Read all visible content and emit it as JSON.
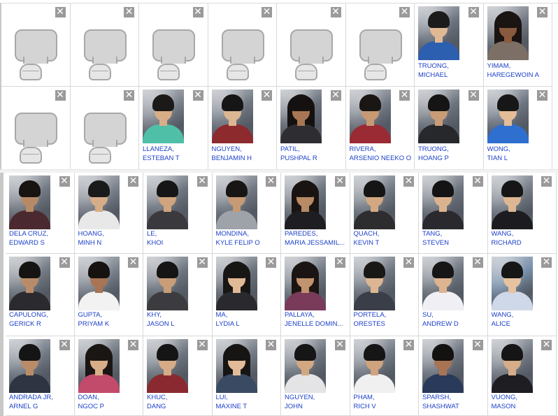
{
  "close_glyph": "✕",
  "placeholder_icon": "silhouette-placeholder-icon",
  "section1": [
    {
      "type": "placeholder"
    },
    {
      "type": "placeholder"
    },
    {
      "type": "placeholder"
    },
    {
      "type": "placeholder"
    },
    {
      "type": "placeholder"
    },
    {
      "type": "placeholder"
    },
    {
      "type": "student",
      "last": "TRUONG,",
      "first": "MICHAEL",
      "bg": "#6d7480",
      "shirt": "#2c5fb0",
      "skin": "#e0b894",
      "hair": "#1b1b1b",
      "longhair": false
    },
    {
      "type": "student",
      "last": "YIMAM,",
      "first": "HAREGEWOIN A",
      "bg": "#767c86",
      "shirt": "#7c6f66",
      "skin": "#8a5a3e",
      "hair": "#1a1412",
      "longhair": true
    },
    {
      "type": "placeholder"
    },
    {
      "type": "placeholder"
    },
    {
      "type": "student",
      "last": "LLANEZA,",
      "first": "ESTEBAN T",
      "bg": "#7b818a",
      "shirt": "#4fbfa8",
      "skin": "#d8ae88",
      "hair": "#1c1a18",
      "longhair": false
    },
    {
      "type": "student",
      "last": "NGUYEN,",
      "first": "BENJAMIN H",
      "bg": "#707781",
      "shirt": "#8d2a2e",
      "skin": "#dcb592",
      "hair": "#161616",
      "longhair": false
    },
    {
      "type": "student",
      "last": "PATIL,",
      "first": "PUSHPAL R",
      "bg": "#6a717b",
      "shirt": "#2e2e32",
      "skin": "#a87654",
      "hair": "#141110",
      "longhair": true
    },
    {
      "type": "student",
      "last": "RIVERA,",
      "first": "ARSENIO NEEKO O",
      "bg": "#747a84",
      "shirt": "#9a2a34",
      "skin": "#c79a74",
      "hair": "#191614",
      "longhair": false
    },
    {
      "type": "student",
      "last": "TRUONG,",
      "first": "HOANG P",
      "bg": "#6d747e",
      "shirt": "#26282c",
      "skin": "#c99c76",
      "hair": "#151515",
      "longhair": false
    },
    {
      "type": "student",
      "last": "WONG,",
      "first": "TIAN L",
      "bg": "#6c7480",
      "shirt": "#2f6fd0",
      "skin": "#e3bc98",
      "hair": "#171717",
      "longhair": false
    }
  ],
  "section2": [
    {
      "last": "DELA CRUZ,",
      "first": "EDWARD S",
      "bg": "#737983",
      "shirt": "#4a2a30",
      "skin": "#b78a66",
      "hair": "#171412",
      "longhair": false
    },
    {
      "last": "HOANG,",
      "first": "MINH N",
      "bg": "#7a808a",
      "shirt": "#e8e8e8",
      "skin": "#d6ad88",
      "hair": "#1a1a1a",
      "longhair": false
    },
    {
      "last": "LE,",
      "first": "KHOI",
      "bg": "#6e757f",
      "shirt": "#3a3a3e",
      "skin": "#cfa47e",
      "hair": "#161616",
      "longhair": false
    },
    {
      "last": "MONDINA,",
      "first": "KYLE FELIP O",
      "bg": "#717882",
      "shirt": "#9ea3aa",
      "skin": "#c59a74",
      "hair": "#181614",
      "longhair": false
    },
    {
      "last": "PAREDES,",
      "first": "MARIA JESSAMIL...",
      "bg": "#6f7680",
      "shirt": "#1e1e22",
      "skin": "#b98a66",
      "hair": "#191411",
      "longhair": true
    },
    {
      "last": "QUACH,",
      "first": "KEVIN T",
      "bg": "#737a84",
      "shirt": "#2d2d30",
      "skin": "#d2a882",
      "hair": "#151515",
      "longhair": false
    },
    {
      "last": "TANG,",
      "first": "STEVEN",
      "bg": "#6c737d",
      "shirt": "#2a2a2e",
      "skin": "#dab38e",
      "hair": "#141414",
      "longhair": false
    },
    {
      "last": "WANG,",
      "first": "RICHARD",
      "bg": "#767d87",
      "shirt": "#1c1c20",
      "skin": "#ddb692",
      "hair": "#161616",
      "longhair": false
    },
    {
      "last": "CAPULONG,",
      "first": "GERICK R",
      "bg": "#727983",
      "shirt": "#2b2b2f",
      "skin": "#b88c68",
      "hair": "#161412",
      "longhair": false
    },
    {
      "last": "GUPTA,",
      "first": "PRIYAM K",
      "bg": "#7a818b",
      "shirt": "#f2f2f2",
      "skin": "#a87454",
      "hair": "#151210",
      "longhair": false
    },
    {
      "last": "KHY,",
      "first": "JASON L",
      "bg": "#6e757f",
      "shirt": "#3c3c40",
      "skin": "#c99d78",
      "hair": "#151515",
      "longhair": false
    },
    {
      "last": "MA,",
      "first": "LYDIA L",
      "bg": "#6b727c",
      "shirt": "#2a2a2e",
      "skin": "#e0ba96",
      "hair": "#181615",
      "longhair": true
    },
    {
      "last": "PALLAYA,",
      "first": "JENELLE DOMIN...",
      "bg": "#747b85",
      "shirt": "#7a3a5a",
      "skin": "#c2946e",
      "hair": "#1a1512",
      "longhair": true
    },
    {
      "last": "PORTELA,",
      "first": "ORESTES",
      "bg": "#707781",
      "shirt": "#3a3e48",
      "skin": "#dcb693",
      "hair": "#1a1816",
      "longhair": false
    },
    {
      "last": "SU,",
      "first": "ANDREW D",
      "bg": "#6f7680",
      "shirt": "#f0f0f4",
      "skin": "#dcb490",
      "hair": "#161616",
      "longhair": false
    },
    {
      "last": "WANG,",
      "first": "ALICE",
      "bg": "#768eaa",
      "shirt": "#cfd8e8",
      "skin": "#e6c2a0",
      "hair": "#161616",
      "longhair": false
    },
    {
      "last": "ANDRADA JR,",
      "first": "ARNEL G",
      "bg": "#727a86",
      "shirt": "#2e3442",
      "skin": "#b98c68",
      "hair": "#151515",
      "longhair": false
    },
    {
      "last": "DOAN,",
      "first": "NGOC P",
      "bg": "#707780",
      "shirt": "#c24a6a",
      "skin": "#d8ae88",
      "hair": "#1a1614",
      "longhair": true
    },
    {
      "last": "KHUC,",
      "first": "DANG",
      "bg": "#6e757f",
      "shirt": "#8a2a30",
      "skin": "#d6ac86",
      "hair": "#151515",
      "longhair": false
    },
    {
      "last": "LUI,",
      "first": "MAXINE T",
      "bg": "#737a84",
      "shirt": "#3a4a62",
      "skin": "#e2bc98",
      "hair": "#171514",
      "longhair": true
    },
    {
      "last": "NGUYEN,",
      "first": "JOHN",
      "bg": "#6c737d",
      "shirt": "#e4e4e6",
      "skin": "#d2a882",
      "hair": "#161616",
      "longhair": false
    },
    {
      "last": "PHAM,",
      "first": "RICH V",
      "bg": "#727983",
      "shirt": "#f0f0f0",
      "skin": "#cfa37e",
      "hair": "#161616",
      "longhair": false
    },
    {
      "last": "SPARSH,",
      "first": "SHASHWAT",
      "bg": "#6e7580",
      "shirt": "#2a3a5a",
      "skin": "#a87454",
      "hair": "#141210",
      "longhair": false
    },
    {
      "last": "VUONG,",
      "first": "MASON",
      "bg": "#737a84",
      "shirt": "#1e1e22",
      "skin": "#d6ad88",
      "hair": "#151515",
      "longhair": false
    }
  ]
}
